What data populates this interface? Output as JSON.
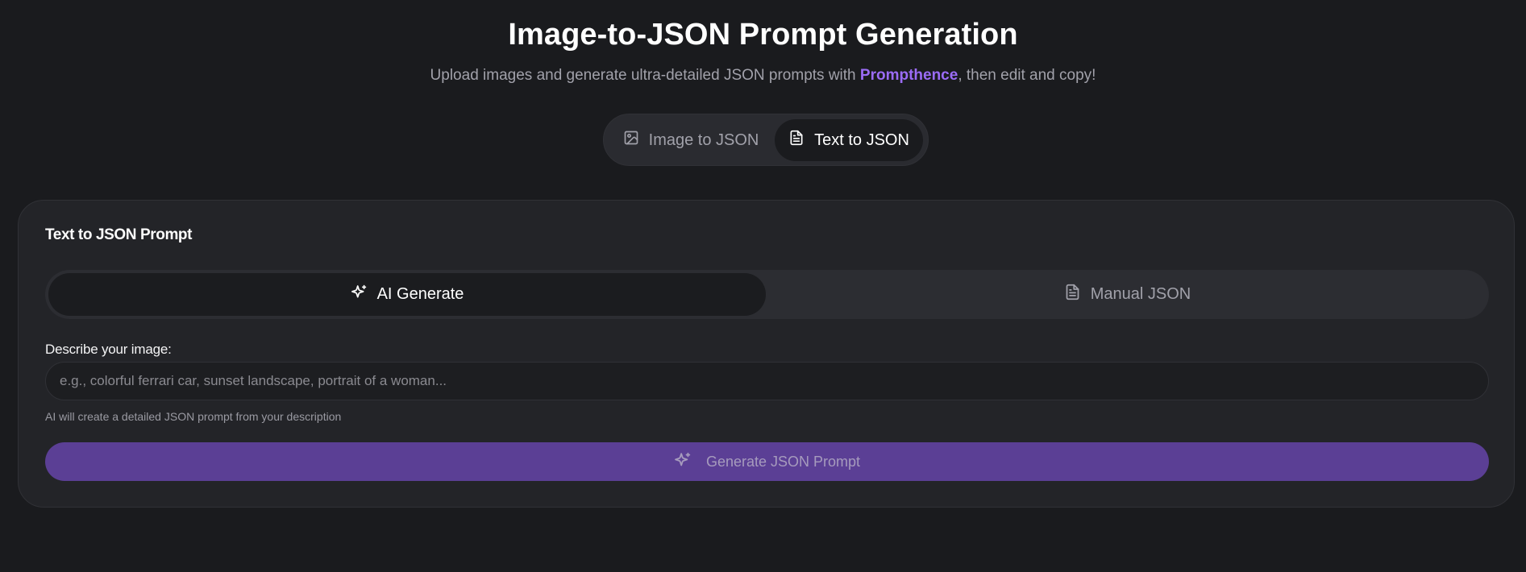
{
  "header": {
    "title": "Image-to-JSON Prompt Generation",
    "subtitle_before": "Upload images and generate ultra-detailed JSON prompts with ",
    "subtitle_brand": "Prompthence",
    "subtitle_after": ", then edit and copy!"
  },
  "mode_toggle": {
    "image_label": "Image to JSON",
    "image_icon": "image-icon",
    "text_label": "Text to JSON",
    "text_icon": "file-text-icon",
    "active": "Text to JSON"
  },
  "card": {
    "title": "Text to JSON Prompt",
    "tabs": {
      "ai_label": "AI Generate",
      "ai_icon": "sparkles-icon",
      "manual_label": "Manual JSON",
      "manual_icon": "file-text-icon",
      "active": "AI Generate"
    },
    "field_label": "Describe your image:",
    "input_value": "",
    "input_placeholder": "e.g., colorful ferrari car, sunset landscape, portrait of a woman...",
    "hint": "AI will create a detailed JSON prompt from your description",
    "generate_label": "Generate JSON Prompt",
    "generate_icon": "sparkles-icon"
  },
  "colors": {
    "background": "#1a1b1e",
    "card": "#232428",
    "brand_accent": "#9b6cf6",
    "button_primary": "#5b3f95"
  }
}
